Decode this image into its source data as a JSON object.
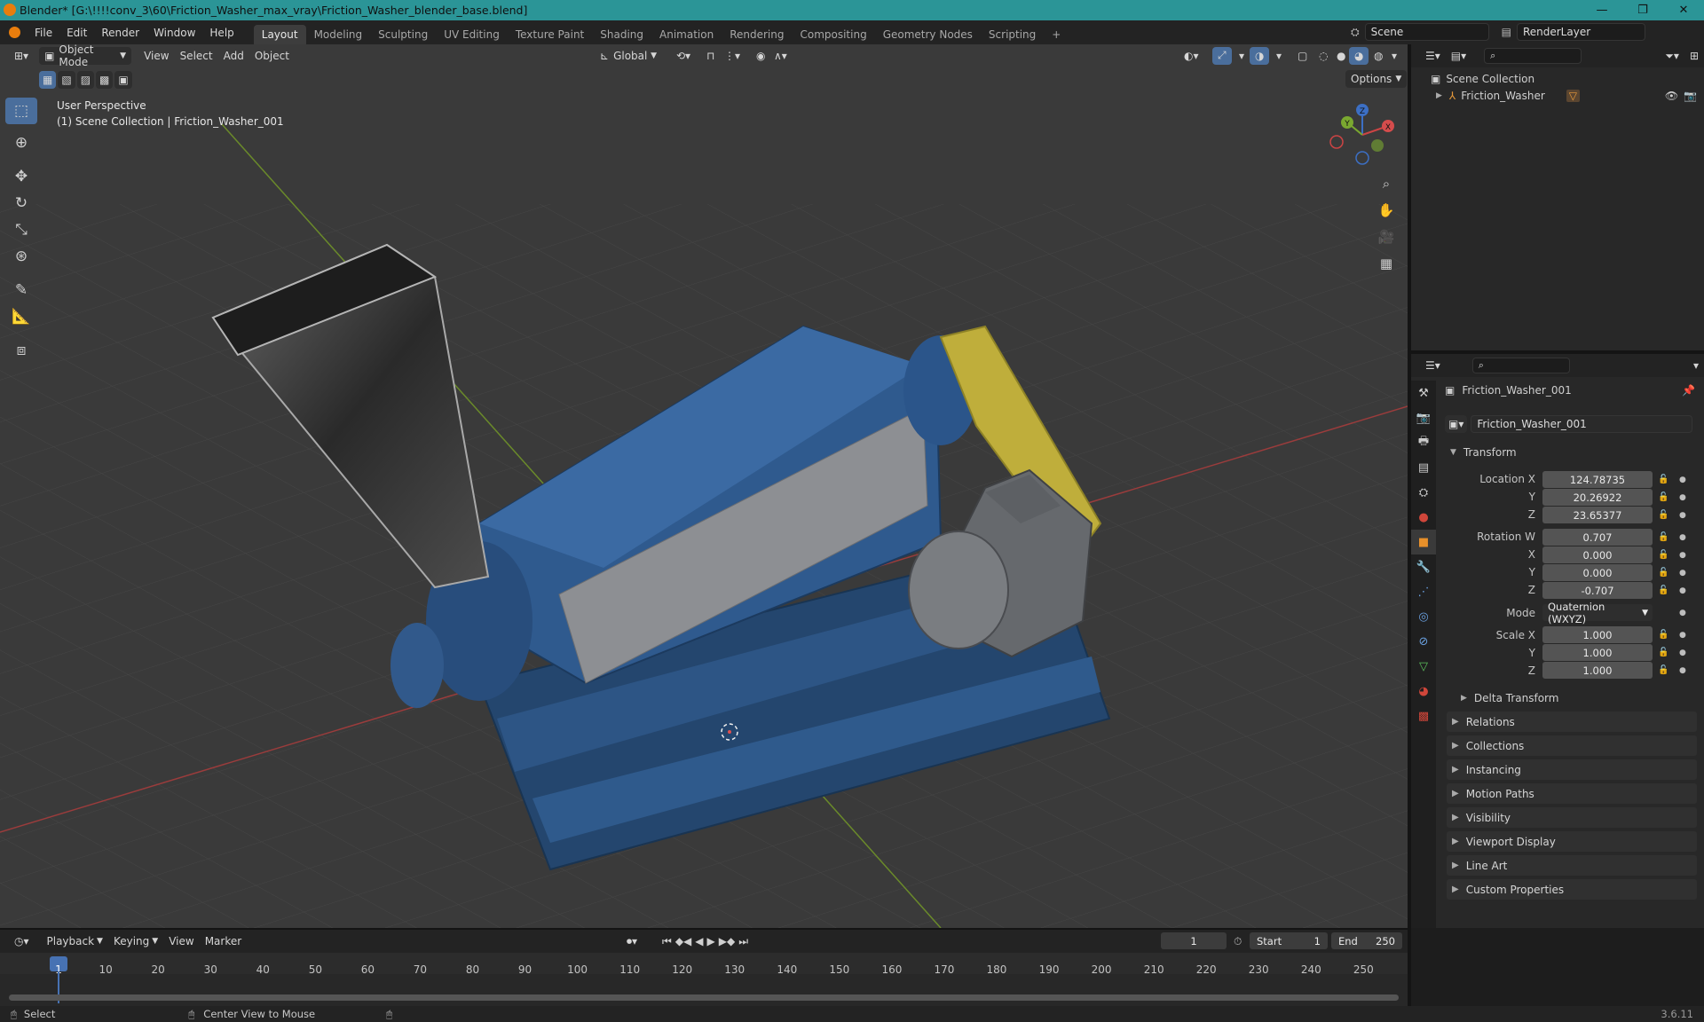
{
  "titlebar": {
    "title": "Blender* [G:\\!!!!conv_3\\60\\Friction_Washer_max_vray\\Friction_Washer_blender_base.blend]",
    "min": "—",
    "max": "❐",
    "close": "✕"
  },
  "menu": [
    "File",
    "Edit",
    "Render",
    "Window",
    "Help"
  ],
  "workspaces": [
    "Layout",
    "Modeling",
    "Sculpting",
    "UV Editing",
    "Texture Paint",
    "Shading",
    "Animation",
    "Rendering",
    "Compositing",
    "Geometry Nodes",
    "Scripting"
  ],
  "active_workspace": "Layout",
  "add_workspace": "+",
  "scene": "Scene",
  "view_layer": "RenderLayer",
  "viewport": {
    "mode": "Object Mode",
    "menus": [
      "View",
      "Select",
      "Add",
      "Object"
    ],
    "orientation": "Global",
    "options": "Options",
    "overlay_line1": "User Perspective",
    "overlay_line2": "(1) Scene Collection | Friction_Washer_001",
    "gizmo": {
      "x": "X",
      "y": "Y",
      "z": "Z"
    }
  },
  "outliner": {
    "root": "Scene Collection",
    "item": "Friction_Washer"
  },
  "properties": {
    "object_name": "Friction_Washer_001",
    "datablock": "Friction_Washer_001",
    "transform_label": "Transform",
    "location_label": "Location X",
    "location": [
      "124.78735",
      "20.26922",
      "23.65377"
    ],
    "rotation_label": "Rotation W",
    "rotation": [
      "0.707",
      "0.000",
      "0.000",
      "-0.707"
    ],
    "mode_label": "Mode",
    "mode": "Quaternion (WXYZ)",
    "scale_label": "Scale X",
    "scale": [
      "1.000",
      "1.000",
      "1.000"
    ],
    "axis_y": "Y",
    "axis_z": "Z",
    "axis_x": "X",
    "delta": "Delta Transform",
    "panels": [
      "Relations",
      "Collections",
      "Instancing",
      "Motion Paths",
      "Visibility",
      "Viewport Display",
      "Line Art",
      "Custom Properties"
    ]
  },
  "timeline": {
    "menus": [
      "Playback",
      "Keying",
      "View",
      "Marker"
    ],
    "current_frame": "1",
    "start_label": "Start",
    "start": "1",
    "end_label": "End",
    "end": "250",
    "ruler": [
      "1",
      "10",
      "20",
      "30",
      "40",
      "50",
      "60",
      "70",
      "80",
      "90",
      "100",
      "110",
      "120",
      "130",
      "140",
      "150",
      "160",
      "170",
      "180",
      "190",
      "200",
      "210",
      "220",
      "230",
      "240",
      "250"
    ]
  },
  "status": {
    "select": "Select",
    "center": "Center View to Mouse",
    "version": "3.6.11"
  }
}
